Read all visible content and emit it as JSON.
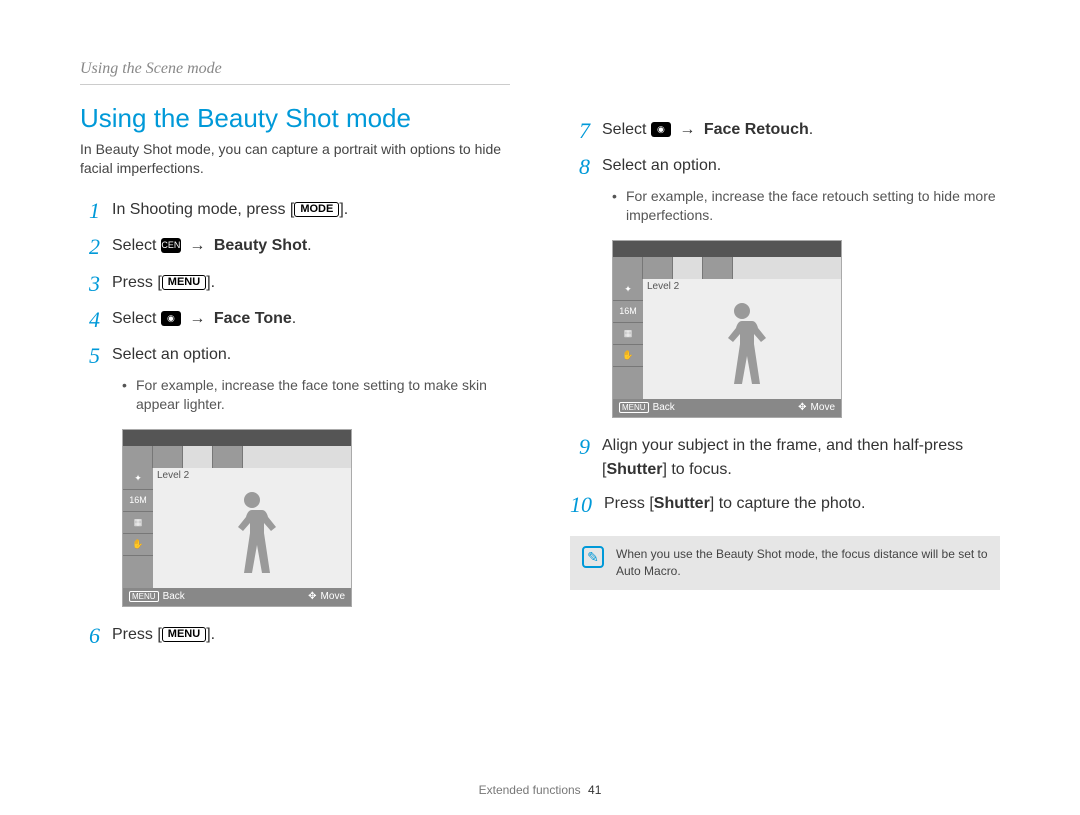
{
  "breadcrumb": "Using the Scene mode",
  "title": "Using the Beauty Shot mode",
  "intro": "In Beauty Shot mode, you can capture a portrait with options to hide facial imperfections.",
  "buttons": {
    "mode": "MODE",
    "menu": "MENU"
  },
  "icons": {
    "scene": "SCENE",
    "camera": "◉"
  },
  "arrows": {
    "right": "→"
  },
  "left_steps": {
    "s1a": "In Shooting mode, press [",
    "s1b": "].",
    "s2a": "Select ",
    "s2b": "Beauty Shot",
    "s2c": ".",
    "s3a": "Press [",
    "s3b": "].",
    "s4a": "Select ",
    "s4b": "Face Tone",
    "s4c": ".",
    "s5": "Select an option.",
    "s5_bullet": "For example, increase the face tone setting to make skin appear lighter.",
    "s6a": "Press [",
    "s6b": "]."
  },
  "right_steps": {
    "s7a": "Select ",
    "s7b": "Face Retouch",
    "s7c": ".",
    "s8": "Select an option.",
    "s8_bullet": "For example, increase the face retouch setting to hide more imperfections.",
    "s9a": "Align your subject in the frame, and then half-press [",
    "s9b": "Shutter",
    "s9c": "] to focus.",
    "s10a": "Press [",
    "s10b": "Shutter",
    "s10c": "] to capture the photo."
  },
  "nums": {
    "n1": "1",
    "n2": "2",
    "n3": "3",
    "n4": "4",
    "n5": "5",
    "n6": "6",
    "n7": "7",
    "n8": "8",
    "n9": "9",
    "n10": "10"
  },
  "lcd": {
    "level": "Level 2",
    "back_btn": "MENU",
    "back": "Back",
    "move_glyph": "✥",
    "move": "Move",
    "side1": "✦",
    "side2": "16M",
    "side3": "▦",
    "side4": "✋"
  },
  "note": "When you use the Beauty Shot mode, the focus distance will be set to Auto Macro.",
  "footer": {
    "section": "Extended functions",
    "page": "41"
  }
}
